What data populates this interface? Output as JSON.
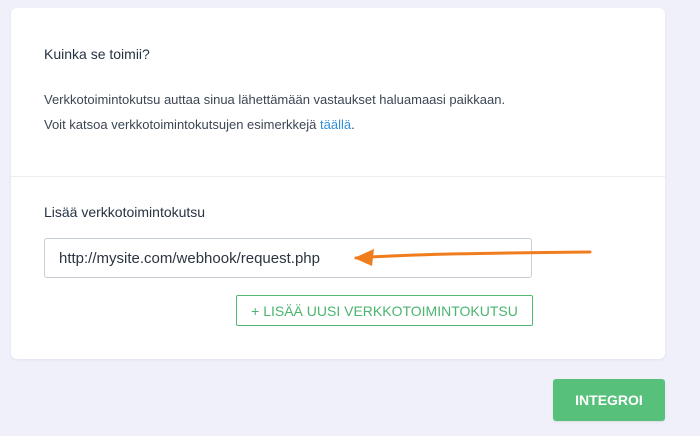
{
  "how_it_works": {
    "title": "Kuinka se toimii?",
    "line1": "Verkkotoimintokutsu auttaa sinua lähettämään vastaukset haluamaasi paikkaan.",
    "line2_prefix": "Voit katsoa verkkotoimintokutsujen esimerkkejä ",
    "link_text": "täällä",
    "line2_suffix": "."
  },
  "add_webhook": {
    "title": "Lisää verkkotoimintokutsu",
    "input_value": "http://mysite.com/webhook/request.php",
    "add_button_label": "+ LISÄÄ UUSI VERKKOTOIMINTOKUTSU"
  },
  "actions": {
    "integrate_label": "INTEGROI"
  },
  "colors": {
    "background": "#f0f0fa",
    "card": "#ffffff",
    "accent_green": "#57c17c",
    "link_blue": "#2f8fd8",
    "arrow_orange": "#f07d1d"
  }
}
